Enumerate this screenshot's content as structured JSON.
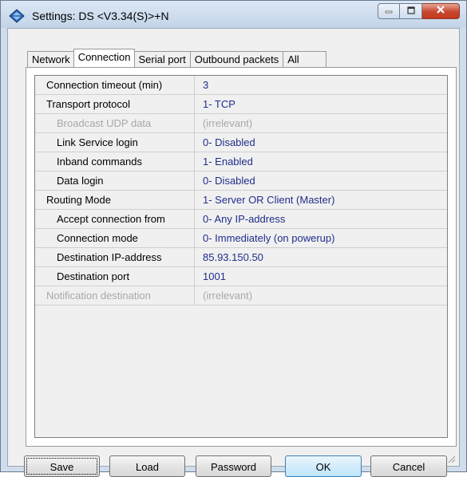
{
  "window": {
    "title": "Settings: DS <V3.34(S)>+N"
  },
  "tabs": [
    {
      "label": "Network",
      "active": false
    },
    {
      "label": "Connection",
      "active": true
    },
    {
      "label": "Serial port",
      "active": false
    },
    {
      "label": "Outbound packets",
      "active": false
    },
    {
      "label": "All",
      "active": false
    }
  ],
  "settings": [
    {
      "key": "Connection timeout (min)",
      "value": "3",
      "indent": false,
      "disabled": false
    },
    {
      "key": "Transport protocol",
      "value": "1- TCP",
      "indent": false,
      "disabled": false
    },
    {
      "key": "Broadcast UDP data",
      "value": "(irrelevant)",
      "indent": true,
      "disabled": true
    },
    {
      "key": "Link Service login",
      "value": "0- Disabled",
      "indent": true,
      "disabled": false
    },
    {
      "key": "Inband commands",
      "value": "1- Enabled",
      "indent": true,
      "disabled": false
    },
    {
      "key": "Data login",
      "value": "0- Disabled",
      "indent": true,
      "disabled": false
    },
    {
      "key": "Routing Mode",
      "value": "1- Server OR Client (Master)",
      "indent": false,
      "disabled": false
    },
    {
      "key": "Accept connection from",
      "value": "0- Any IP-address",
      "indent": true,
      "disabled": false
    },
    {
      "key": "Connection mode",
      "value": "0- Immediately (on powerup)",
      "indent": true,
      "disabled": false
    },
    {
      "key": "Destination IP-address",
      "value": "85.93.150.50",
      "indent": true,
      "disabled": false
    },
    {
      "key": "Destination port",
      "value": "1001",
      "indent": true,
      "disabled": false
    },
    {
      "key": "Notification destination",
      "value": "(irrelevant)",
      "indent": false,
      "disabled": true
    }
  ],
  "buttons": {
    "save": "Save",
    "load": "Load",
    "password": "Password",
    "ok": "OK",
    "cancel": "Cancel"
  },
  "colors": {
    "value_text": "#1f2e8a",
    "disabled_text": "#a8a8a8",
    "window_frame": "#cfdded"
  },
  "icons": {
    "app": "network-device-icon",
    "minimize": "minimize-icon",
    "maximize": "maximize-icon",
    "close": "close-icon",
    "resize": "resize-grip-icon"
  }
}
